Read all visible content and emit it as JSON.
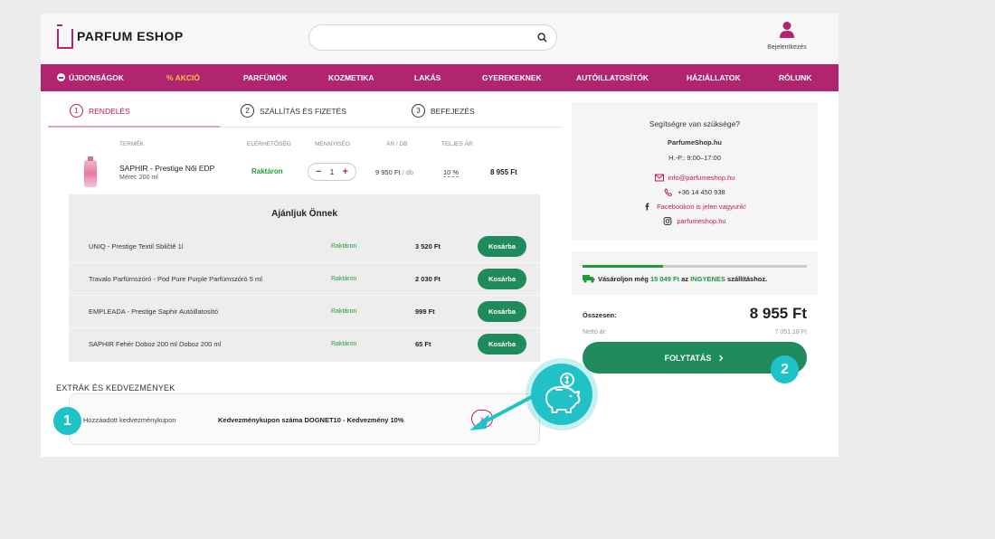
{
  "brand": {
    "name": "PARFUM ESHOP",
    "accent": "#b0256f",
    "green": "#1f8a5c",
    "teal": "#1ec3c8"
  },
  "search": {
    "placeholder": "",
    "icon": "search-icon"
  },
  "login": {
    "label": "Bejelentkezés",
    "icon": "user-icon"
  },
  "nav": {
    "items": [
      "ÚJDONSÁGOK",
      "% AKCIÓ",
      "PARFÜMÖK",
      "KOZMETIKA",
      "LAKÁS",
      "GYEREKEKNEK",
      "AUTÓILLATOSÍTÓK",
      "HÁZIÁLLATOK",
      "RÓLUNK"
    ]
  },
  "steps": [
    {
      "num": "1",
      "label": "RENDELÉS"
    },
    {
      "num": "2",
      "label": "SZÁLLÍTÁS ÉS FIZETÉS"
    },
    {
      "num": "3",
      "label": "BEFEJEZÉS"
    }
  ],
  "cart": {
    "headers": [
      "TERMÉK",
      "ELÉRHETŐSÉG",
      "MENNYISÉG",
      "ÁR / DB",
      "TELJES ÁR"
    ],
    "item": {
      "name": "SAPHIR - Prestige Női EDP",
      "size": "Méret: 200 ml",
      "availability": "Raktáron",
      "qty": "1",
      "minus": "−",
      "plus": "+",
      "unit_price": "9 950 Ft",
      "unit_suffix": " / db",
      "discount": "10 %",
      "total": "8 955 Ft"
    }
  },
  "recommend": {
    "title": "Ajánljuk Önnek",
    "button": "Kosárba",
    "rows": [
      {
        "name": "UNIQ - Prestige Textil Sbličtě 1l",
        "stock": "Raktáron",
        "price": "3 520 Ft"
      },
      {
        "name": "Travalo Parfümszóró - Pod Pure Purple Parfümszóró 5 ml",
        "stock": "Raktáron",
        "price": "2 030 Ft"
      },
      {
        "name": "EMPLEADA - Prestige Saphir Autóillatosító",
        "stock": "Raktáron",
        "price": "999 Ft"
      },
      {
        "name": "SAPHIR Fehér Doboz 200 ml Doboz 200 ml",
        "stock": "Raktáron",
        "price": "65 Ft"
      }
    ]
  },
  "extras": {
    "title": "EXTRÁK ÉS KEDVEZMÉNYEK",
    "coupon_label": "Hozzáadott kedvezménykupon",
    "coupon_value": "Kedvezménykupon száma DOGNET10 - Kedvezmény 10%",
    "remove": "x"
  },
  "help": {
    "title": "Segítségre van szüksége?",
    "site": "ParfumeShop.hu",
    "hours": "H.-P.: 9:00–17:00",
    "email": "info@parfumeshop.hu",
    "phone": "+36 14 450 938",
    "facebook": "Facebookon is jelen vagyunk!",
    "instagram": "parfumeshop.hu"
  },
  "shipping": {
    "progress": 0.36,
    "text_prefix": "Vásároljon még ",
    "amount": "15 049 Ft",
    "text_mid": " az ",
    "free": "INGYENES",
    "text_suffix": " szállításhoz."
  },
  "summary": {
    "total_label": "Összesen:",
    "total_value": "8 955 Ft",
    "net_label": "Nettó ár:",
    "net_value": "7 051,18 Ft",
    "continue": "FOLYTATÁS"
  },
  "annotations": {
    "badge1": "1",
    "badge2": "2"
  }
}
